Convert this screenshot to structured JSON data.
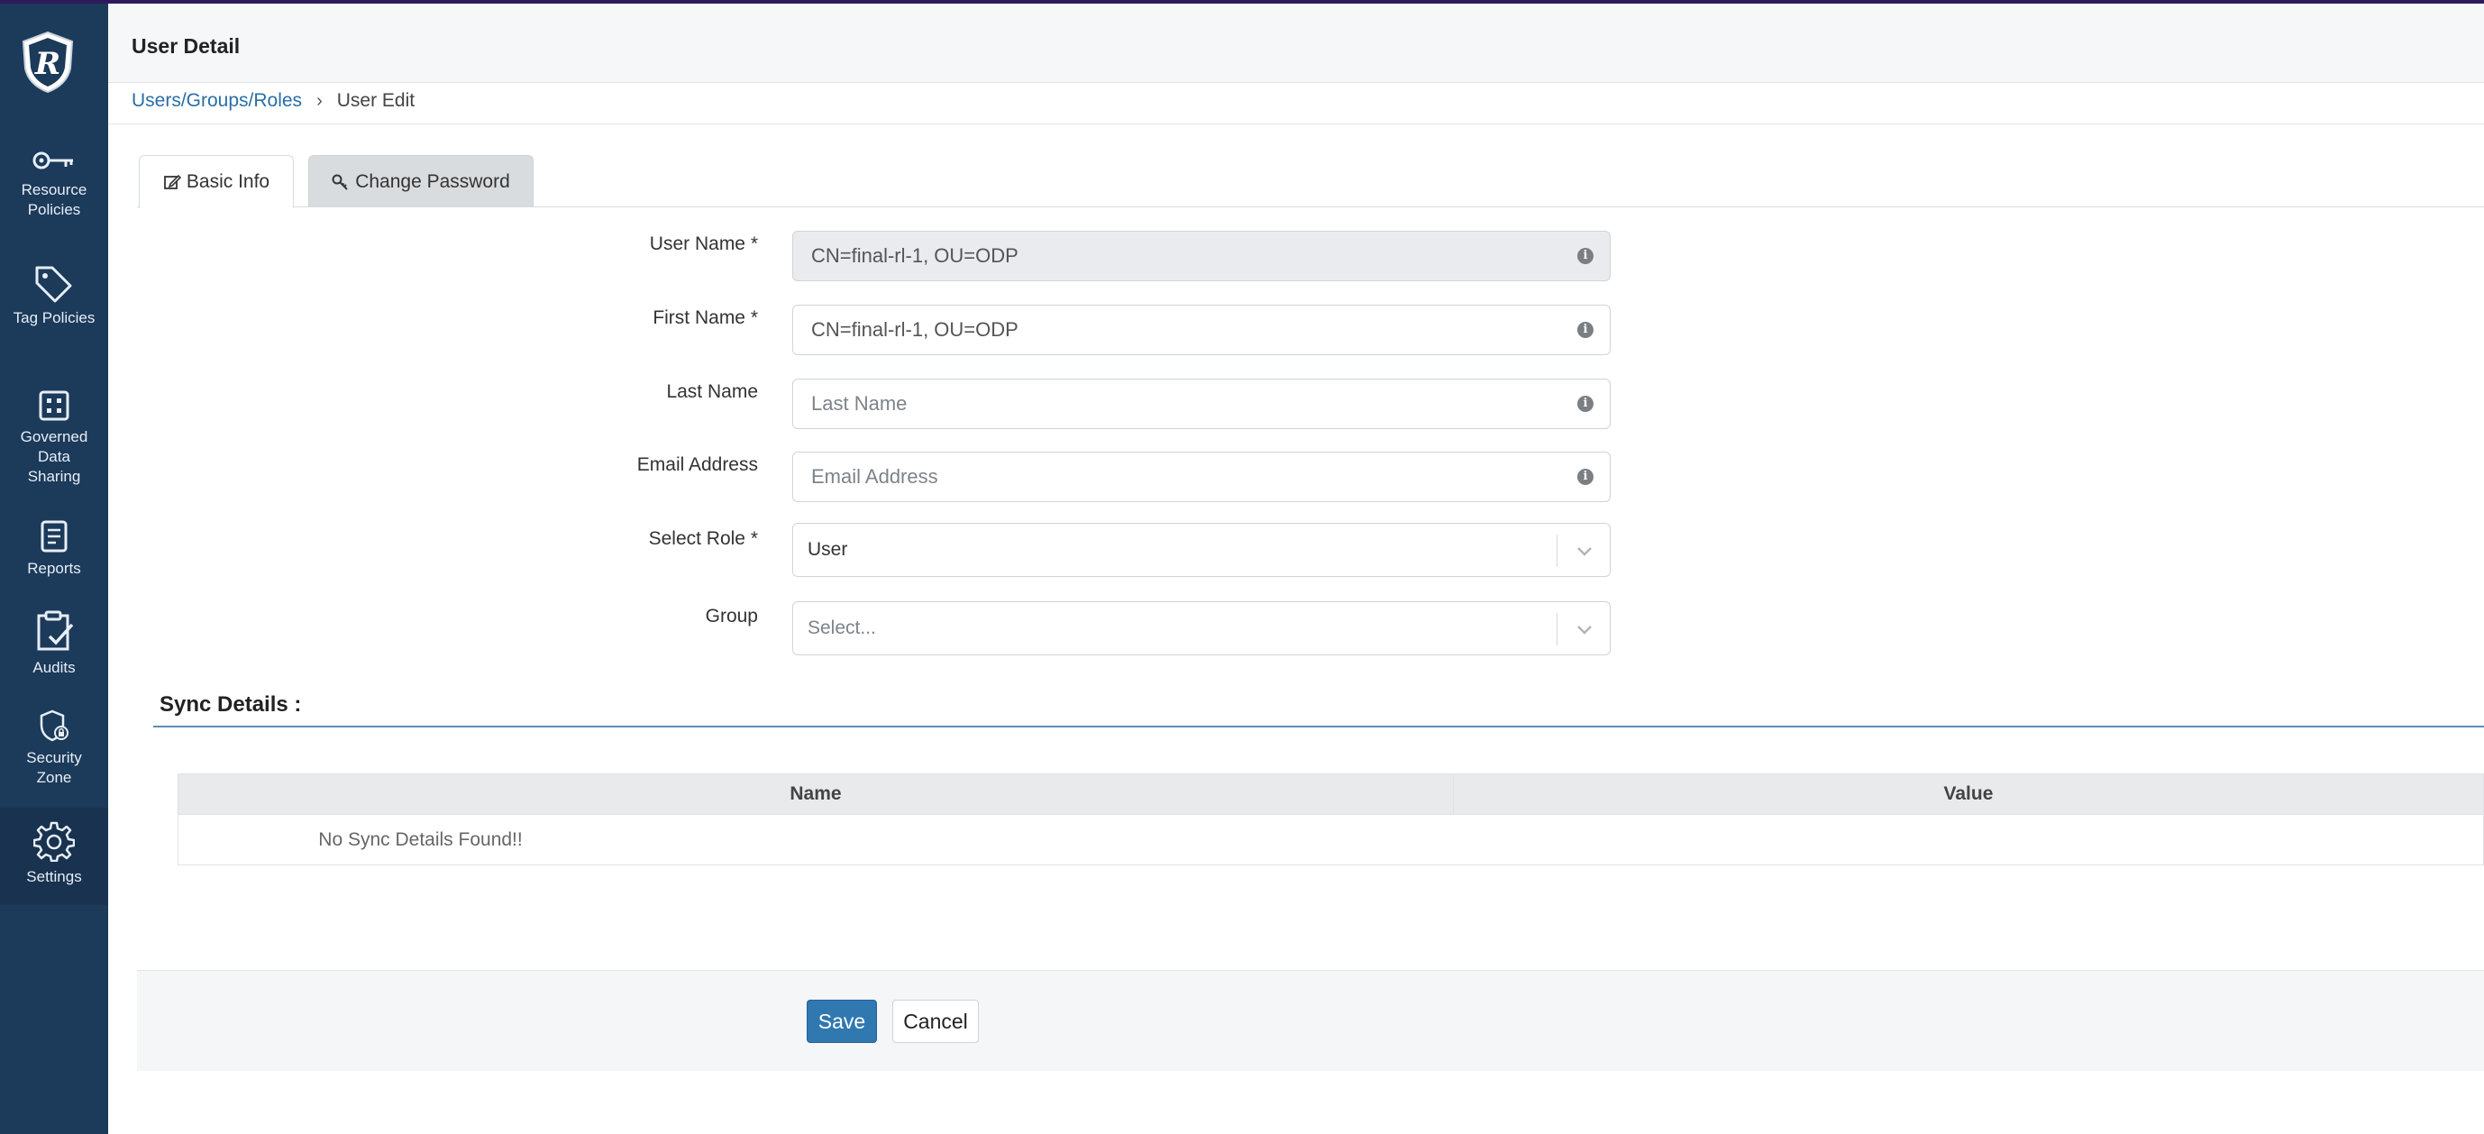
{
  "sidebar": {
    "items": [
      {
        "label": "Resource Policies",
        "icon": "key-icon"
      },
      {
        "label": "Tag Policies",
        "icon": "tag-icon"
      },
      {
        "label": "Governed Data Sharing",
        "icon": "grid-icon"
      },
      {
        "label": "Reports",
        "icon": "report-icon"
      },
      {
        "label": "Audits",
        "icon": "clipboard-check-icon"
      },
      {
        "label": "Security Zone",
        "icon": "shield-lock-icon"
      },
      {
        "label": "Settings",
        "icon": "gear-icon"
      }
    ]
  },
  "header": {
    "title": "User Detail"
  },
  "breadcrumb": {
    "parent": "Users/Groups/Roles",
    "current": "User Edit"
  },
  "tabs": [
    {
      "label": "Basic Info",
      "icon": "edit-icon"
    },
    {
      "label": "Change Password",
      "icon": "key-icon"
    }
  ],
  "form": {
    "user_name": {
      "label": "User Name *",
      "value": "CN=final-rl-1, OU=ODP"
    },
    "first_name": {
      "label": "First Name *",
      "value": "CN=final-rl-1, OU=ODP"
    },
    "last_name": {
      "label": "Last Name",
      "placeholder": "Last Name"
    },
    "email": {
      "label": "Email Address",
      "placeholder": "Email Address"
    },
    "role": {
      "label": "Select Role *",
      "value": "User"
    },
    "group": {
      "label": "Group",
      "placeholder": "Select..."
    }
  },
  "sync": {
    "title": "Sync Details :",
    "columns": [
      "Name",
      "Value"
    ],
    "empty_text": "No Sync Details Found!!"
  },
  "footer": {
    "save_label": "Save",
    "cancel_label": "Cancel"
  },
  "colors": {
    "sidebar": "#1c3a5a",
    "accent": "#2f78b0",
    "link": "#2a6ea6"
  }
}
